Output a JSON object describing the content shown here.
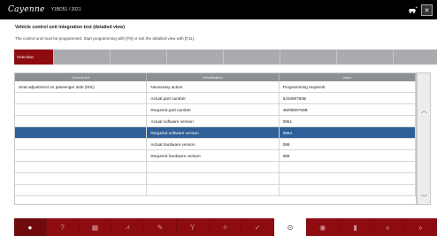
{
  "titlebar": {
    "brand": "Cayenne",
    "vehicle": "Y1BD51 / 2021",
    "icons": [
      "car-link-icon",
      "close-icon"
    ]
  },
  "page": {
    "heading": "Vehicle control unit integration test (detailed view)",
    "subheading": "The control unit must be programmed. Start programming with [F8] or exit the detailed view with [F11]."
  },
  "tabs": [
    {
      "label": "Overview",
      "active": true
    },
    {
      "label": "",
      "active": false
    },
    {
      "label": "",
      "active": false
    },
    {
      "label": "",
      "active": false
    },
    {
      "label": "",
      "active": false
    },
    {
      "label": "",
      "active": false
    },
    {
      "label": "",
      "active": false
    },
    {
      "label": "",
      "active": false
    }
  ],
  "table": {
    "headers": [
      "Control unit",
      "Identification",
      "Value"
    ],
    "rows": [
      {
        "control_unit": "Seat adjustment on passenger side (001)",
        "identification": "Necessary action",
        "value": "Programming required!",
        "selected": false
      },
      {
        "control_unit": "",
        "identification": "Actual part number",
        "value": "6J1959760B",
        "selected": false
      },
      {
        "control_unit": "",
        "identification": "Required part number",
        "value": "4M0959750B",
        "selected": false
      },
      {
        "control_unit": "",
        "identification": "Actual software version",
        "value": "0951",
        "selected": false
      },
      {
        "control_unit": "",
        "identification": "Required software version",
        "value": "0954",
        "selected": true
      },
      {
        "control_unit": "",
        "identification": "Actual hardware version",
        "value": "089",
        "selected": false
      },
      {
        "control_unit": "",
        "identification": "Required hardware version",
        "value": "089",
        "selected": false
      },
      {
        "control_unit": "",
        "identification": "",
        "value": "",
        "selected": false
      },
      {
        "control_unit": "",
        "identification": "",
        "value": "",
        "selected": false
      },
      {
        "control_unit": "",
        "identification": "",
        "value": "",
        "selected": false
      }
    ]
  },
  "scrollbar": {
    "up_icon": "chevron-up-icon",
    "down_icon": "chevron-down-icon"
  },
  "toolbar": {
    "buttons": [
      {
        "icon": "home-icon",
        "glyph": "●",
        "kind": "home"
      },
      {
        "icon": "help-icon",
        "glyph": "?",
        "kind": "normal"
      },
      {
        "icon": "grid-icon",
        "glyph": "▦",
        "kind": "normal"
      },
      {
        "icon": "chart-icon",
        "glyph": "⩘",
        "kind": "normal"
      },
      {
        "icon": "wrench-icon",
        "glyph": "✎",
        "kind": "normal"
      },
      {
        "icon": "filter-icon",
        "glyph": "Y",
        "kind": "normal"
      },
      {
        "icon": "tool-icon",
        "glyph": "✧",
        "kind": "normal"
      },
      {
        "icon": "check-icon",
        "glyph": "✓",
        "kind": "normal"
      },
      {
        "icon": "proceed-icon",
        "glyph": "⊙",
        "kind": "proceed"
      },
      {
        "icon": "record-icon",
        "glyph": "◉",
        "kind": "normal"
      },
      {
        "icon": "trash-icon",
        "glyph": "▮",
        "kind": "normal"
      },
      {
        "icon": "back-icon",
        "glyph": "«",
        "kind": "normal"
      },
      {
        "icon": "forward-icon",
        "glyph": "»",
        "kind": "normal"
      }
    ]
  },
  "colors": {
    "accent": "#8e0c10",
    "selected_row": "#2e5f96",
    "tab_bar": "#a9abae"
  }
}
